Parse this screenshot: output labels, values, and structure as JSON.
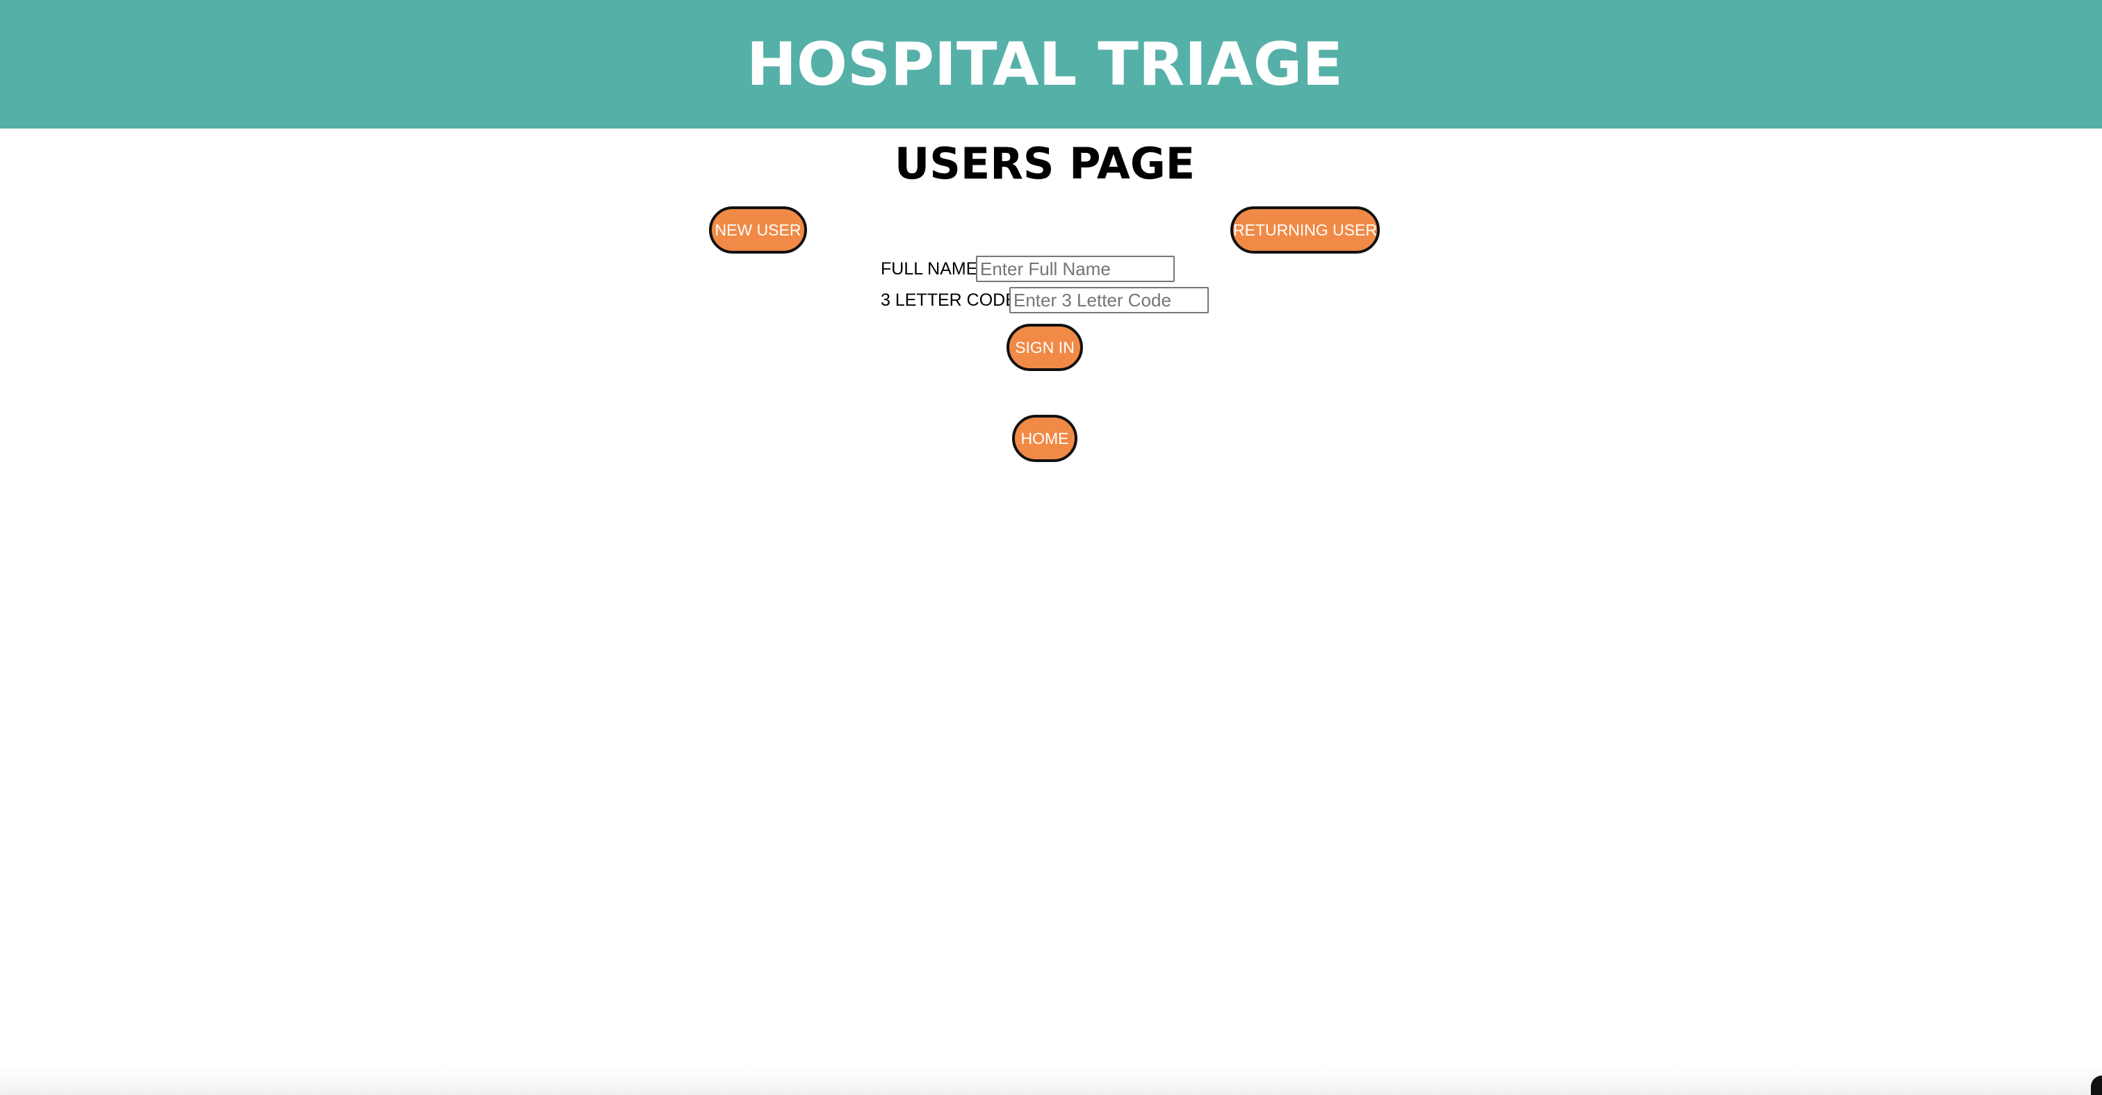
{
  "header": {
    "title": "HOSPITAL TRIAGE",
    "background_color": "#55b0a8"
  },
  "page": {
    "title": "USERS PAGE"
  },
  "buttons": {
    "new_user": "NEW USER",
    "returning_user": "RETURNING USER",
    "sign_in": "SIGN IN",
    "home": "HOME",
    "color": "#f08a46"
  },
  "form": {
    "full_name_label": "FULL NAME:",
    "full_name_value": "",
    "full_name_placeholder": "Enter Full Name",
    "code_label": "3 LETTER CODE:",
    "code_value": "",
    "code_placeholder": "Enter 3 Letter Code"
  }
}
